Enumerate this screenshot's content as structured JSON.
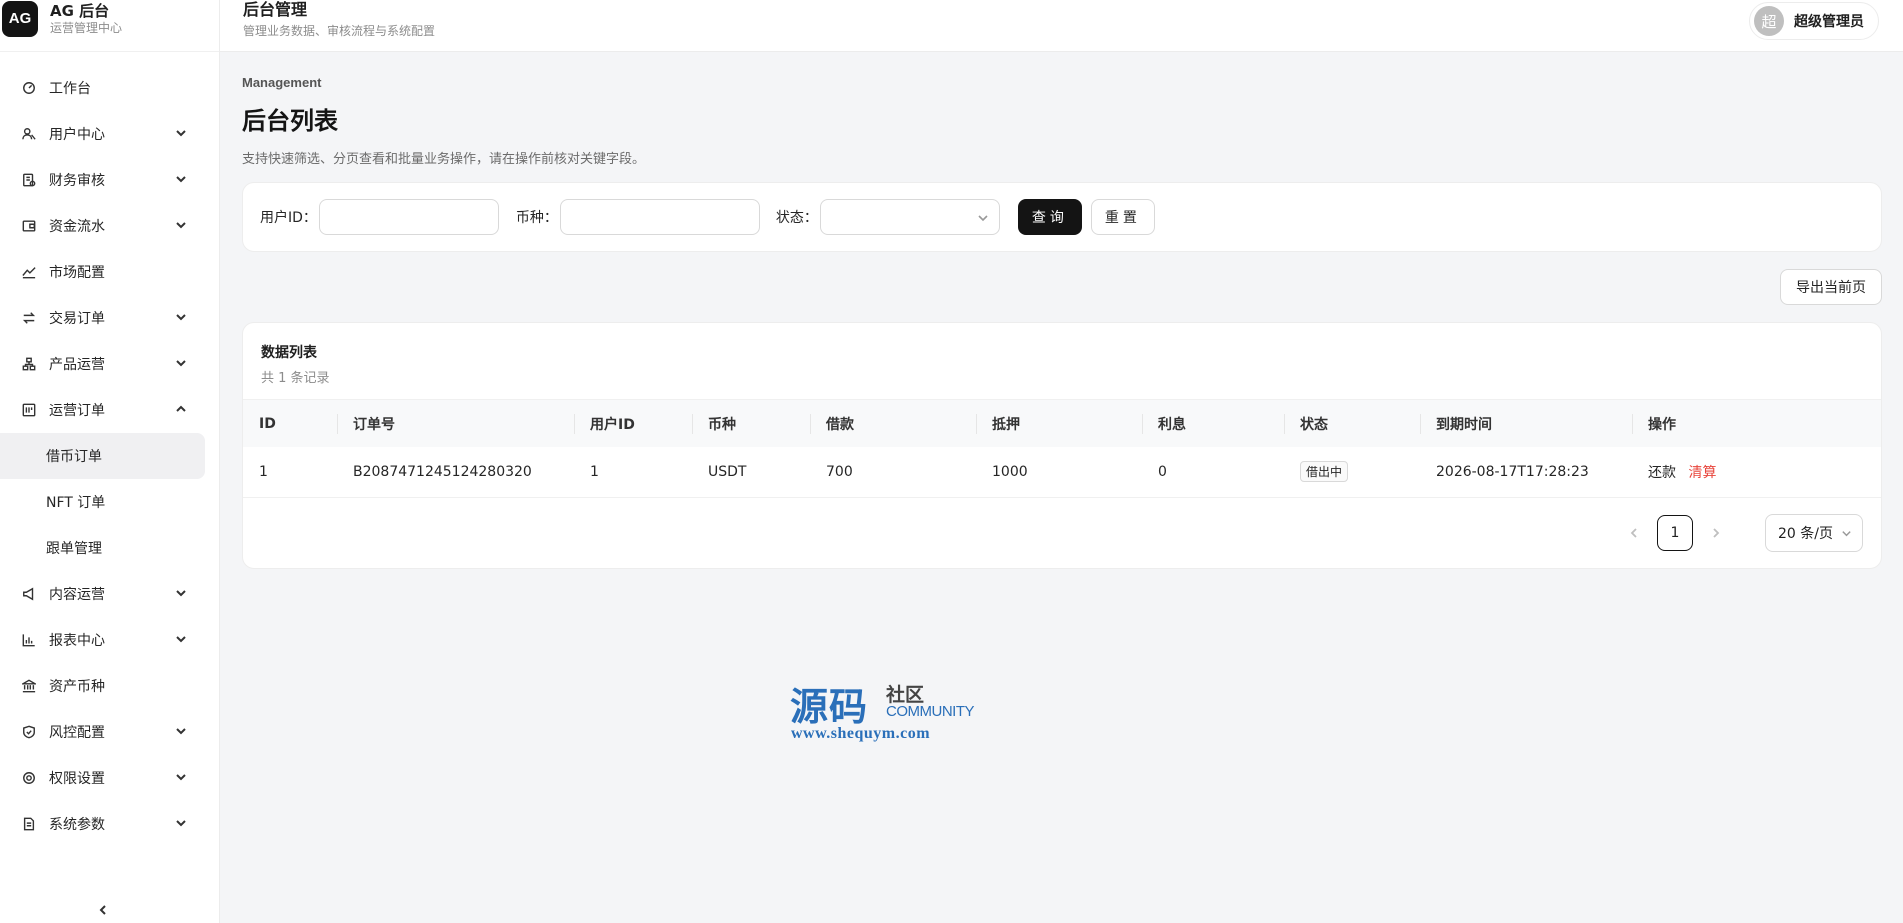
{
  "brand": {
    "logo": "AG",
    "title": "AG 后台",
    "subtitle": "运营管理中心"
  },
  "header": {
    "title": "后台管理",
    "subtitle": "管理业务数据、审核流程与系统配置",
    "avatar": "超",
    "user": "超级管理员"
  },
  "sidebar": {
    "items": [
      {
        "label": "工作台",
        "icon": "dashboard-icon",
        "chevron": ""
      },
      {
        "label": "用户中心",
        "icon": "users-icon",
        "chevron": "down"
      },
      {
        "label": "财务审核",
        "icon": "finance-icon",
        "chevron": "down"
      },
      {
        "label": "资金流水",
        "icon": "wallet-icon",
        "chevron": "down"
      },
      {
        "label": "市场配置",
        "icon": "chart-line-icon",
        "chevron": ""
      },
      {
        "label": "交易订单",
        "icon": "exchange-icon",
        "chevron": "down"
      },
      {
        "label": "产品运营",
        "icon": "product-icon",
        "chevron": "down"
      },
      {
        "label": "运营订单",
        "icon": "orders-icon",
        "chevron": "up"
      }
    ],
    "sub_items": [
      {
        "label": "借币订单",
        "active": true
      },
      {
        "label": "NFT 订单",
        "active": false
      },
      {
        "label": "跟单管理",
        "active": false
      }
    ],
    "items2": [
      {
        "label": "内容运营",
        "icon": "megaphone-icon",
        "chevron": "down"
      },
      {
        "label": "报表中心",
        "icon": "bar-chart-icon",
        "chevron": "down"
      },
      {
        "label": "资产币种",
        "icon": "bank-icon",
        "chevron": ""
      },
      {
        "label": "风控配置",
        "icon": "shield-icon",
        "chevron": "down"
      },
      {
        "label": "权限设置",
        "icon": "gear-icon",
        "chevron": "down"
      },
      {
        "label": "系统参数",
        "icon": "doc-icon",
        "chevron": "down"
      }
    ]
  },
  "page": {
    "eyebrow": "Management",
    "title": "后台列表",
    "description": "支持快速筛选、分页查看和批量业务操作，请在操作前核对关键字段。"
  },
  "filters": {
    "user_id_label": "用户ID：",
    "user_id_value": "",
    "currency_label": "币种：",
    "currency_value": "",
    "status_label": "状态：",
    "status_value": "",
    "query_label": "查询",
    "reset_label": "重置"
  },
  "export_label": "导出当前页",
  "table": {
    "title": "数据列表",
    "count": "共 1 条记录",
    "columns": [
      "ID",
      "订单号",
      "用户ID",
      "币种",
      "借款",
      "抵押",
      "利息",
      "状态",
      "到期时间",
      "操作"
    ],
    "rows": [
      {
        "id": "1",
        "order_no": "B2087471245124280320",
        "user_id": "1",
        "currency": "USDT",
        "loan": "700",
        "collateral": "1000",
        "interest": "0",
        "status": "借出中",
        "due": "2026-08-17T17:28:23",
        "op_repay": "还款",
        "op_liquidate": "清算"
      }
    ]
  },
  "pagination": {
    "current": "1",
    "page_size": "20 条/页"
  },
  "watermark": {
    "big": "源码",
    "small_cn": "社区",
    "small_en": "COMMUNITY",
    "url": "www.shequym.com"
  }
}
